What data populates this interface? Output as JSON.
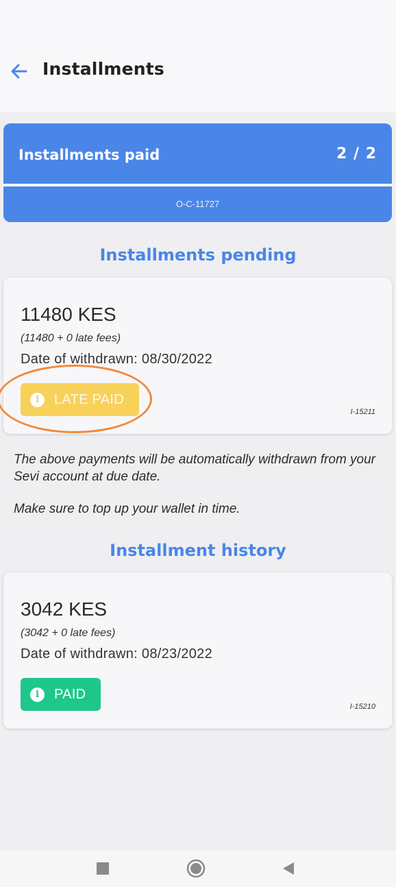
{
  "header": {
    "title": "Installments",
    "back_icon": "arrow-left-icon",
    "accent": "#4a86e8"
  },
  "summary": {
    "label": "Installments paid",
    "count": "2 / 2",
    "code": "O-C-11727",
    "color": "#4a86e8"
  },
  "pending": {
    "title": "Installments pending",
    "items": [
      {
        "amount": "11480 KES",
        "fees": "(11480 + 0 late fees)",
        "date": "Date of withdrawn: 08/30/2022",
        "status": "LATE PAID",
        "status_color": "#f7d15a",
        "id": "I-15211"
      }
    ]
  },
  "notes": {
    "line1": "The above payments will be automatically withdrawn from your Sevi account at due date.",
    "line2": "Make sure to top up your wallet in time."
  },
  "history": {
    "title": "Installment history",
    "items": [
      {
        "amount": "3042 KES",
        "fees": "(3042 + 0 late fees)",
        "date": "Date of withdrawn: 08/23/2022",
        "status": "PAID",
        "status_color": "#1dc88a",
        "id": "I-15210"
      }
    ]
  },
  "badge_icon": {
    "glyph": "i",
    "name": "info-icon"
  },
  "navbar": {
    "recents_icon": "square-icon",
    "home_icon": "circle-home-icon",
    "back_icon": "triangle-back-icon"
  }
}
